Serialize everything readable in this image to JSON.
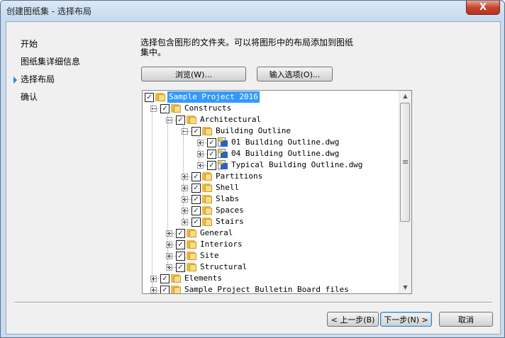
{
  "window": {
    "title": "创建图纸集 - 选择布局",
    "close_label": "X"
  },
  "steps": [
    {
      "label": "开始"
    },
    {
      "label": "图纸集详细信息"
    },
    {
      "label": "选择布局",
      "current": true
    },
    {
      "label": "确认"
    }
  ],
  "instruction": "选择包含图形的文件夹。可以将图形中的布局添加到图纸集中。",
  "buttons": {
    "browse": "浏览(W)...",
    "import_options": "输入选项(O)...",
    "back": "< 上一步(B)",
    "next": "下一步(N) >",
    "cancel": "取消"
  },
  "tree": {
    "rows": [
      {
        "label": "Sample Project 2016",
        "type": "folder",
        "checked": true,
        "depth": 0,
        "expander": "",
        "selected": true
      },
      {
        "label": "Constructs",
        "type": "folder",
        "checked": true,
        "depth": 1,
        "expander": "minus"
      },
      {
        "label": "Architectural",
        "type": "folder",
        "checked": true,
        "depth": 2,
        "expander": "minus"
      },
      {
        "label": "Building Outline",
        "type": "folder",
        "checked": true,
        "depth": 3,
        "expander": "minus"
      },
      {
        "label": "01 Building Outline.dwg",
        "type": "dwg",
        "checked": true,
        "depth": 4,
        "expander": "plus"
      },
      {
        "label": "04 Building Outline.dwg",
        "type": "dwg",
        "checked": true,
        "depth": 4,
        "expander": "plus"
      },
      {
        "label": "Typical Building Outline.dwg",
        "type": "dwg",
        "checked": true,
        "depth": 4,
        "expander": "plus"
      },
      {
        "label": "Partitions",
        "type": "folder",
        "checked": true,
        "depth": 3,
        "expander": "plus"
      },
      {
        "label": "Shell",
        "type": "folder",
        "checked": true,
        "depth": 3,
        "expander": "plus"
      },
      {
        "label": "Slabs",
        "type": "folder",
        "checked": true,
        "depth": 3,
        "expander": "plus"
      },
      {
        "label": "Spaces",
        "type": "folder",
        "checked": true,
        "depth": 3,
        "expander": "plus"
      },
      {
        "label": "Stairs",
        "type": "folder",
        "checked": true,
        "depth": 3,
        "expander": "plus"
      },
      {
        "label": "General",
        "type": "folder",
        "checked": true,
        "depth": 2,
        "expander": "plus"
      },
      {
        "label": "Interiors",
        "type": "folder",
        "checked": true,
        "depth": 2,
        "expander": "plus"
      },
      {
        "label": "Site",
        "type": "folder",
        "checked": true,
        "depth": 2,
        "expander": "plus"
      },
      {
        "label": "Structural",
        "type": "folder",
        "checked": true,
        "depth": 2,
        "expander": "plus"
      },
      {
        "label": "Elements",
        "type": "folder",
        "checked": true,
        "depth": 1,
        "expander": "plus"
      },
      {
        "label": "Sample Project Bulletin Board_files",
        "type": "folder",
        "checked": true,
        "depth": 1,
        "expander": "plus"
      }
    ]
  },
  "colors": {
    "accent": "#3399ff",
    "arrow": "#2a7fd4",
    "folder": "#f8dd82"
  },
  "icons": {
    "check": "✓",
    "scroll_up": "▲",
    "scroll_down": "▼"
  }
}
